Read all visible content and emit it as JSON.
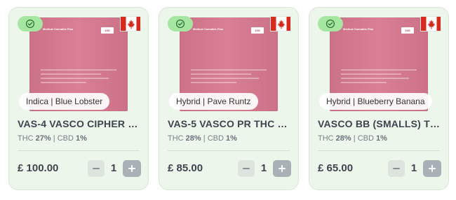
{
  "colors": {
    "card_background": "#edf6ea",
    "badge_green": "#a5e7a1",
    "pouch_pink": "#d8798f",
    "flag_red": "#d52b1e",
    "text_dark": "#3d4450"
  },
  "icons": {
    "verified": "check-circle-icon",
    "country_flag": "canada-flag-icon",
    "decrement": "minus-icon",
    "increment": "plus-icon"
  },
  "products": [
    {
      "strain": "Indica | Blue Lobster",
      "name": "VAS-4 VASCO CIPHER B...",
      "thc_label": "THC",
      "thc_value": "27%",
      "cbd_label": "CBD",
      "cbd_value": "1%",
      "price": "£ 100.00",
      "quantity": "1",
      "package_text": "Medical Cannabis Flos",
      "package_weight": "10G"
    },
    {
      "strain": "Hybrid | Pave Runtz",
      "name": "VAS-5 VASCO PR THC 2...",
      "thc_label": "THC",
      "thc_value": "28%",
      "cbd_label": "CBD",
      "cbd_value": "1%",
      "price": "£ 85.00",
      "quantity": "1",
      "package_text": "Medical Cannabis Flos",
      "package_weight": "10G"
    },
    {
      "strain": "Hybrid | Blueberry Banana",
      "name": "VASCO BB (SMALLS) TH...",
      "thc_label": "THC",
      "thc_value": "28%",
      "cbd_label": "CBD",
      "cbd_value": "1%",
      "price": "£ 65.00",
      "quantity": "1",
      "package_text": "Medical Cannabis Flos",
      "package_weight": "10G"
    }
  ]
}
